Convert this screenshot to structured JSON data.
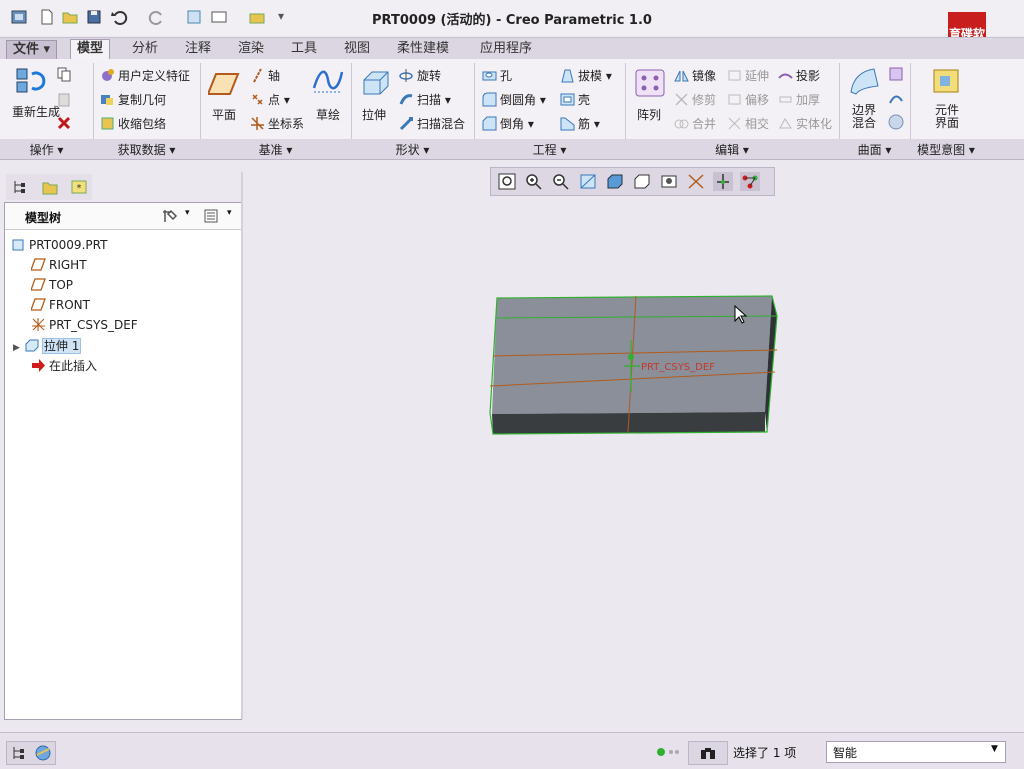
{
  "window": {
    "title": "PRT0009 (活动的) - Creo Parametric 1.0",
    "logo_text": "育碟软件"
  },
  "tabs": [
    {
      "label": "文件",
      "type": "file"
    },
    {
      "label": "模型",
      "active": true
    },
    {
      "label": "分析"
    },
    {
      "label": "注释"
    },
    {
      "label": "渲染"
    },
    {
      "label": "工具"
    },
    {
      "label": "视图"
    },
    {
      "label": "柔性建模"
    },
    {
      "label": "应用程序"
    }
  ],
  "ribbon": {
    "operations": {
      "regen": "重新生成",
      "group": "操作"
    },
    "getdata": {
      "udf": "用户定义特征",
      "copy_geom": "复制几何",
      "shrinkwrap": "收缩包络",
      "group": "获取数据"
    },
    "datum": {
      "plane": "平面",
      "axis": "轴",
      "point": "点",
      "csys": "坐标系",
      "sketch": "草绘",
      "group": "基准"
    },
    "shapes": {
      "extrude": "拉伸",
      "revolve": "旋转",
      "sweep": "扫描",
      "swept_blend": "扫描混合",
      "group": "形状"
    },
    "engineering": {
      "hole": "孔",
      "round": "倒圆角",
      "chamfer": "倒角",
      "draft": "拔模",
      "shell": "壳",
      "rib": "筋",
      "group": "工程"
    },
    "editing": {
      "pattern": "阵列",
      "mirror": "镜像",
      "trim": "修剪",
      "merge": "合并",
      "extend": "延伸",
      "offset": "偏移",
      "intersect": "相交",
      "project": "投影",
      "thicken": "加厚",
      "solidify": "实体化",
      "group": "编辑"
    },
    "surfaces": {
      "boundary_blend": "边界混合",
      "group": "曲面"
    },
    "intent": {
      "component_interface": "元件界面",
      "group": "模型意图"
    }
  },
  "model_tree": {
    "header": "模型树",
    "items": [
      {
        "label": "PRT0009.PRT",
        "icon": "part-icon"
      },
      {
        "label": "RIGHT",
        "icon": "datum-plane-icon"
      },
      {
        "label": "TOP",
        "icon": "datum-plane-icon"
      },
      {
        "label": "FRONT",
        "icon": "datum-plane-icon"
      },
      {
        "label": "PRT_CSYS_DEF",
        "icon": "csys-icon"
      },
      {
        "label": "拉伸 1",
        "icon": "extrude-icon",
        "selected": true,
        "expandable": true
      },
      {
        "label": "在此插入",
        "icon": "insert-here-icon"
      }
    ]
  },
  "graphics": {
    "csys_label": "PRT_CSYS_DEF"
  },
  "status": {
    "selection": "选择了 1 项",
    "filter": "智能"
  },
  "colors": {
    "accent_green": "#2fb12f",
    "datum_red": "#c0392b",
    "model_face": "#8b8f99",
    "model_side": "#3a3d40"
  }
}
